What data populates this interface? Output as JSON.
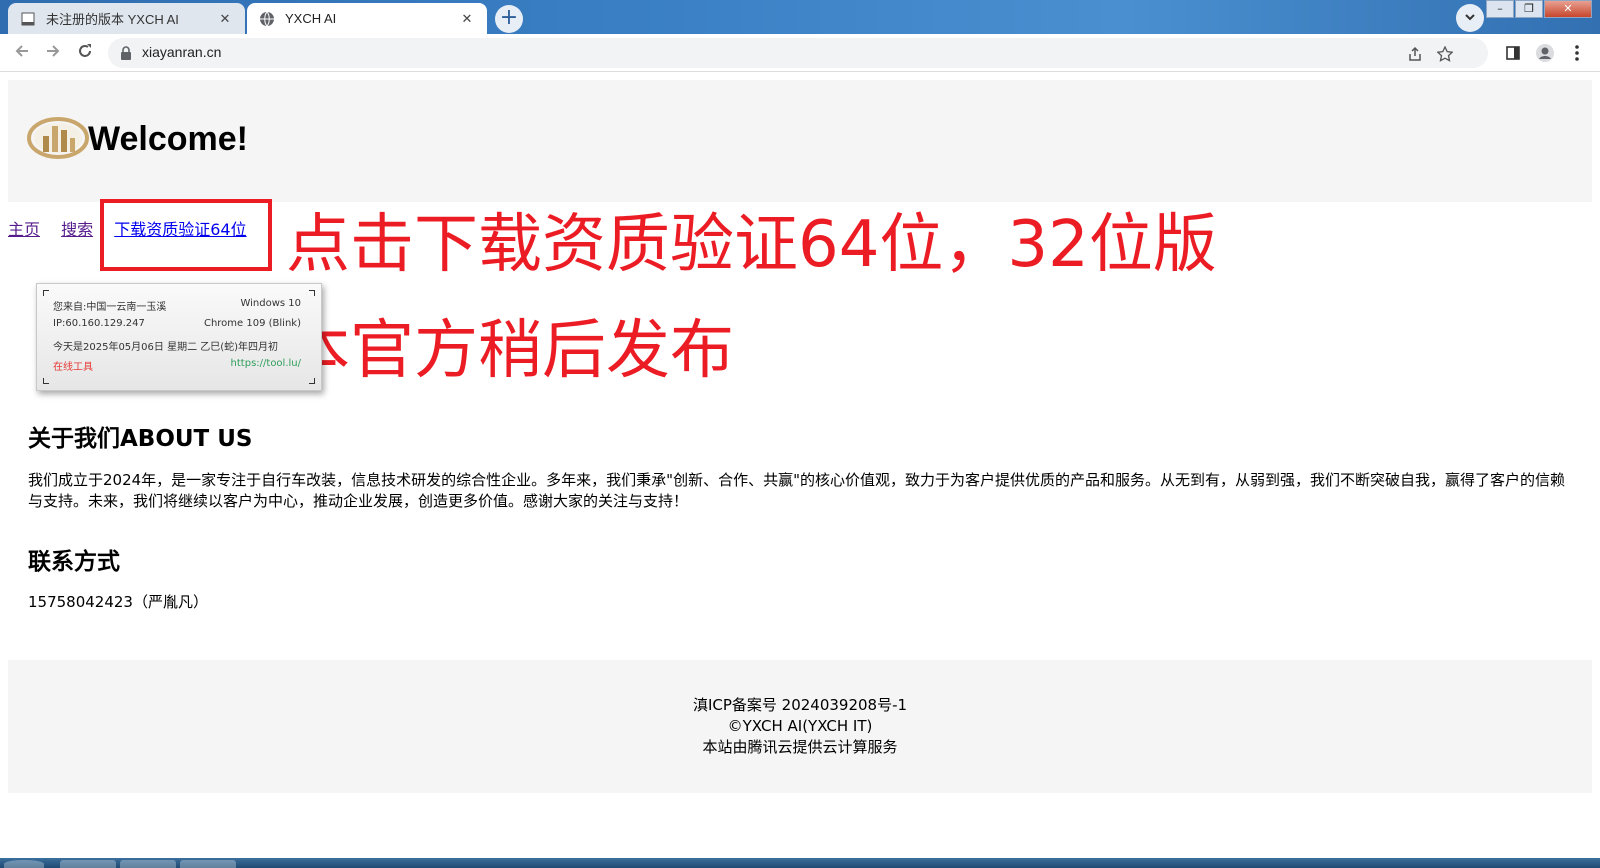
{
  "browser": {
    "tabs": [
      {
        "title": "未注册的版本 YXCH AI",
        "active": false
      },
      {
        "title": "YXCH AI",
        "active": true
      }
    ],
    "new_tab_symbol": "+",
    "close_symbol": "✕",
    "url": "xiayanran.cn",
    "window_controls": {
      "minimize": "–",
      "restore": "❐",
      "close": "✕"
    }
  },
  "page": {
    "welcome": "Welcome!",
    "nav": {
      "home": "主页",
      "search": "搜索",
      "download": "下载资质验证64位"
    },
    "annotation": {
      "line1": "点击下载资质验证64位，32位版",
      "line2": "本官方稍后发布",
      "color": "#ec1c24"
    },
    "widget": {
      "location": "您来自:中国一云南一玉溪",
      "os": "Windows 10",
      "ip": "IP:60.160.129.247",
      "browser": "Chrome 109 (Blink)",
      "date": "今天是2025年05月06日  星期二  乙巳(蛇)年四月初",
      "tool_label": "在线工具",
      "tool_link": "https://tool.lu/"
    },
    "about": {
      "heading": "关于我们ABOUT US",
      "text": "我们成立于2024年，是一家专注于自行车改装，信息技术研发的综合性企业。多年来，我们秉承\"创新、合作、共赢\"的核心价值观，致力于为客户提供优质的产品和服务。从无到有，从弱到强，我们不断突破自我，赢得了客户的信赖与支持。未来，我们将继续以客户为中心，推动企业发展，创造更多价值。感谢大家的关注与支持！"
    },
    "contact": {
      "heading": "联系方式",
      "text": "15758042423（严胤凡）"
    },
    "footer": {
      "icp": "滇ICP备案号 2024039208号-1",
      "copyright": "©YXCH AI(YXCH IT)",
      "hosting": "本站由腾讯云提供云计算服务"
    }
  },
  "icons": [
    "page-icon",
    "globe-icon",
    "back-icon",
    "forward-icon",
    "reload-icon",
    "lock-icon",
    "share-icon",
    "star-icon",
    "side-panel-icon",
    "profile-icon",
    "menu-icon",
    "chevron-down-icon",
    "logo-icon"
  ]
}
